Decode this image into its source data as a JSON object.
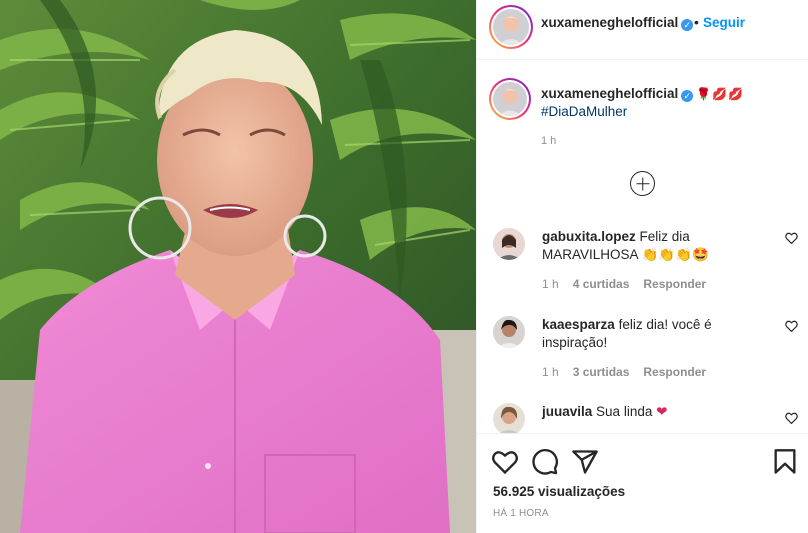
{
  "post": {
    "username": "xuxameneghelofficial",
    "verified_mark": "✓",
    "follow_separator": "•",
    "follow_label": "Seguir",
    "caption_emojis": "🌹💋💋",
    "hashtag": "#DiaDaMulher",
    "caption_time": "1 h",
    "video_description": "Vídeo: mulher de cabelo loiro curto e camisa rosa em frente a folhagens de palmeira"
  },
  "comments": [
    {
      "username": "gabuxita.lopez",
      "text": "Feliz dia MARAVILHOSA 👏👏👏🤩",
      "time": "1 h",
      "likes": "4 curtidas",
      "reply": "Responder"
    },
    {
      "username": "kaaesparza",
      "text": "feliz dia! você é inspiração!",
      "time": "1 h",
      "likes": "3 curtidas",
      "reply": "Responder"
    },
    {
      "username": "juuavila",
      "text": "Sua linda ❤️",
      "time": "",
      "likes": "",
      "reply": ""
    }
  ],
  "stats": {
    "views": "56.925 visualizações",
    "posted": "HÁ 1 HORA"
  },
  "icons": {
    "like": "heart-icon",
    "comment": "comment-icon",
    "share": "share-icon",
    "save": "bookmark-icon",
    "load_more": "plus-circle-icon"
  },
  "colors": {
    "accent": "#0095f6",
    "hashtag": "#00376b",
    "muted": "#8e8e8e",
    "verified": "#3897f0",
    "heart_emoji": "#e0245e"
  }
}
